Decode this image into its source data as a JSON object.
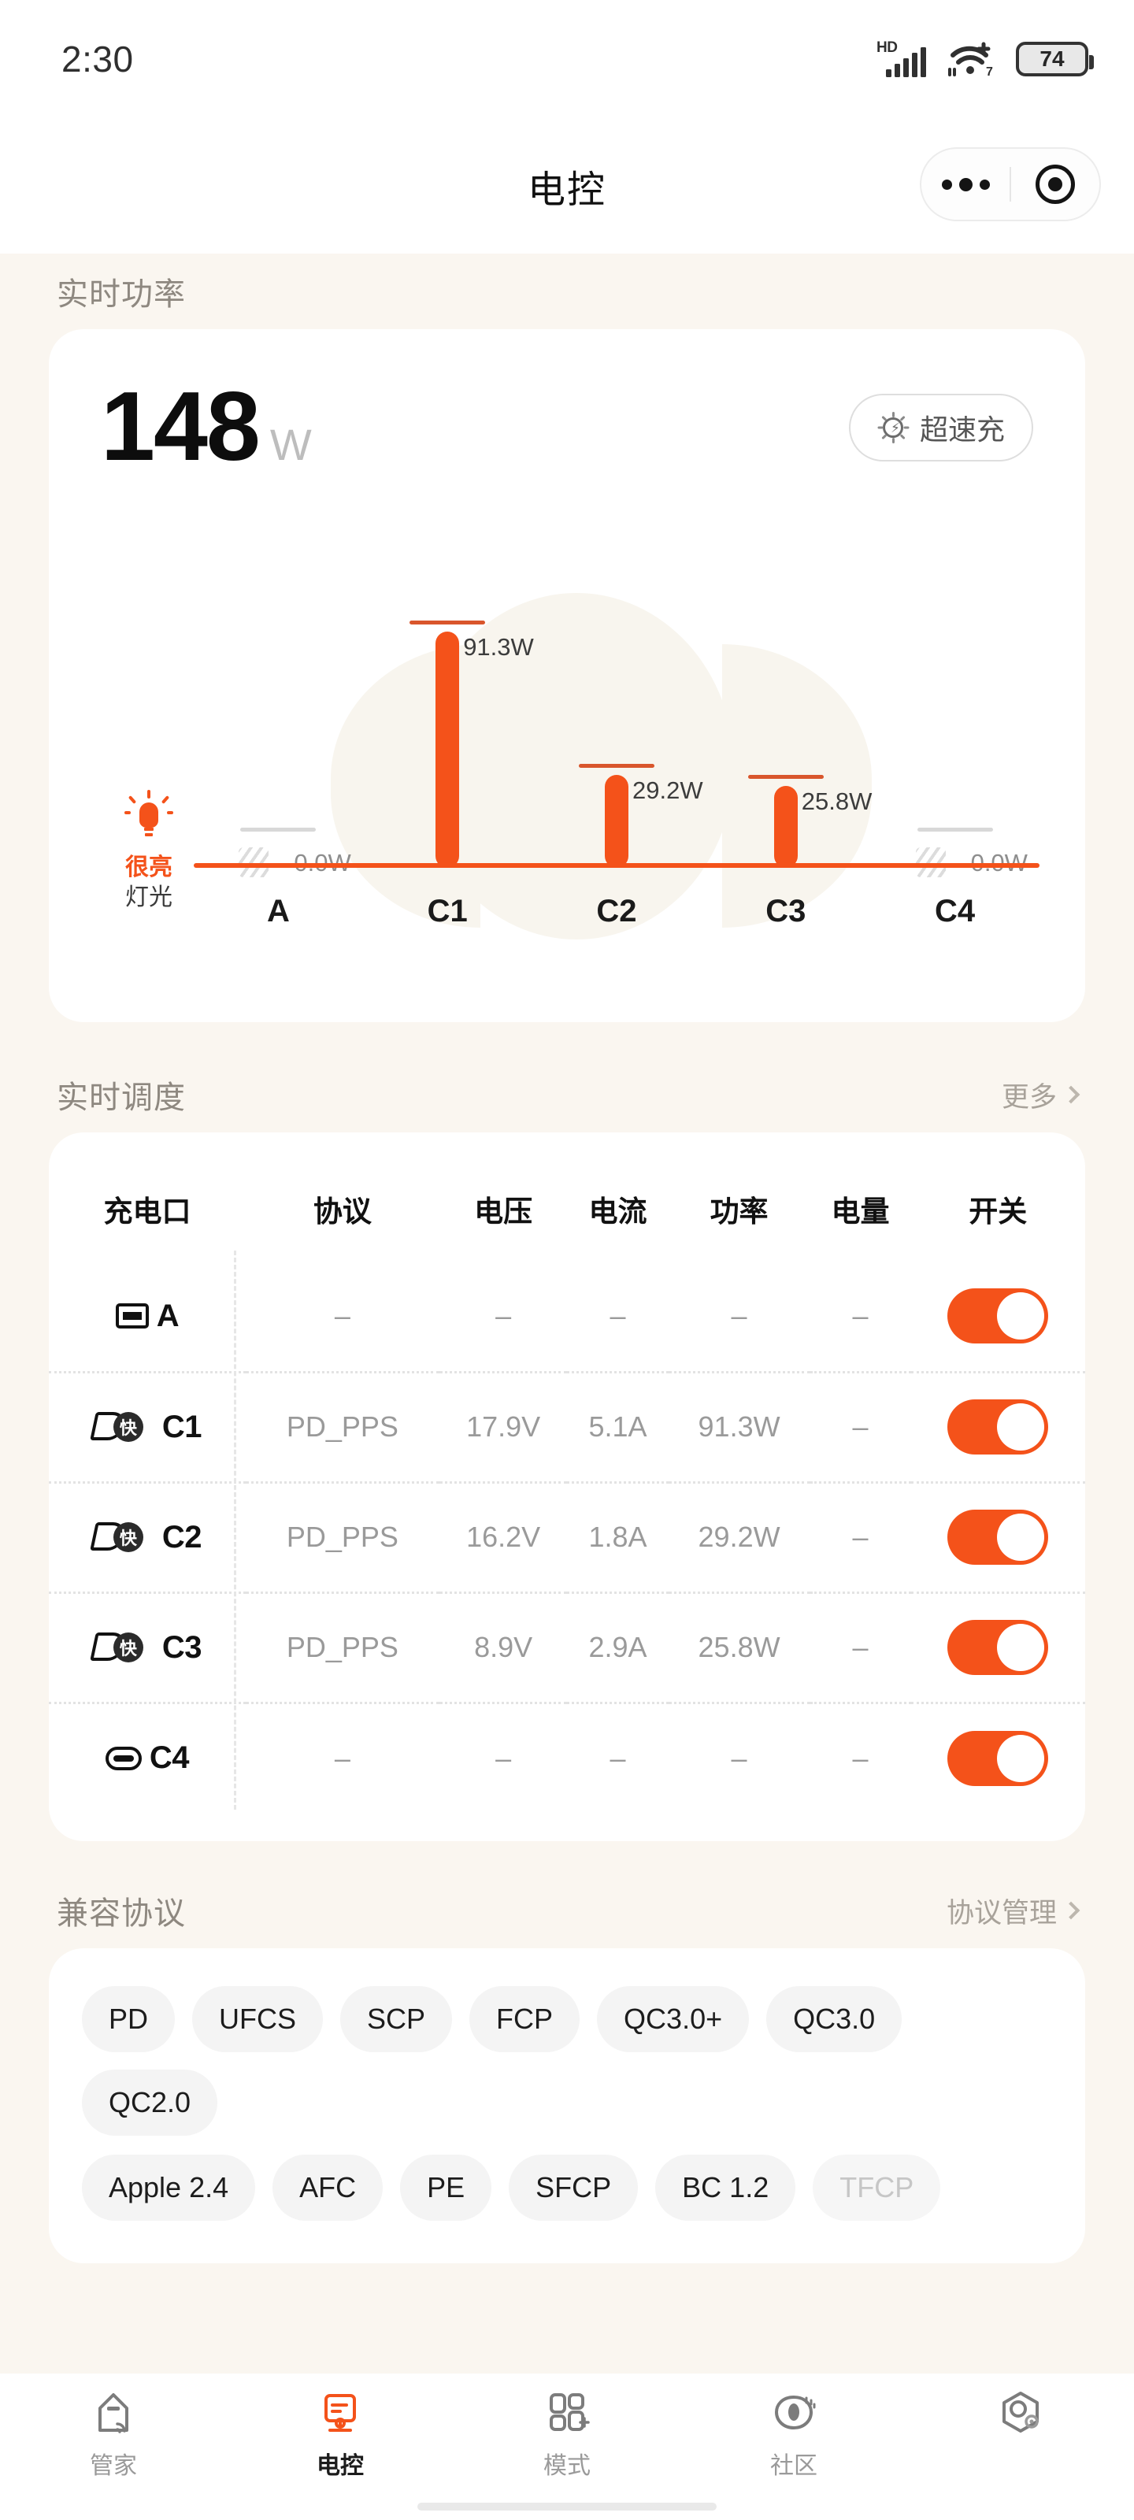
{
  "status_bar": {
    "time": "2:30",
    "network_label": "HD",
    "wifi_label": "7",
    "battery_level": "74"
  },
  "nav": {
    "title": "电控",
    "more_icon": "ellipsis-icon",
    "capsule_icon": "target-icon"
  },
  "power_section": {
    "title": "实时功率",
    "total_value": "148",
    "total_unit": "W",
    "fast_charge_label": "超速充",
    "light_status": "很亮",
    "light_label": "灯光"
  },
  "chart_data": {
    "type": "bar",
    "title": "实时功率",
    "categories": [
      "A",
      "C1",
      "C2",
      "C3",
      "C4"
    ],
    "values": [
      0.0,
      91.3,
      29.2,
      25.8,
      0.0
    ],
    "labels": [
      "0.0W",
      "91.3W",
      "29.2W",
      "25.8W",
      "0.0W"
    ],
    "unit": "W",
    "ylim": [
      0,
      100
    ],
    "grid": false,
    "xlabel": "",
    "ylabel": "",
    "active_color": "#f4521a",
    "inactive_color": "#d8d8d8",
    "total": 148
  },
  "schedule_section": {
    "title": "实时调度",
    "more_label": "更多",
    "columns": [
      "充电口",
      "协议",
      "电压",
      "电流",
      "功率",
      "电量",
      "开关"
    ],
    "rows": [
      {
        "port": "A",
        "icon": "usb-a-port-icon",
        "protocol": "–",
        "voltage": "–",
        "current": "–",
        "power": "–",
        "energy": "–",
        "switch_on": true
      },
      {
        "port": "C1",
        "icon": "usb-c-fast-port-icon",
        "protocol": "PD_PPS",
        "voltage": "17.9V",
        "current": "5.1A",
        "power": "91.3W",
        "energy": "–",
        "switch_on": true
      },
      {
        "port": "C2",
        "icon": "usb-c-fast-port-icon",
        "protocol": "PD_PPS",
        "voltage": "16.2V",
        "current": "1.8A",
        "power": "29.2W",
        "energy": "–",
        "switch_on": true
      },
      {
        "port": "C3",
        "icon": "usb-c-fast-port-icon",
        "protocol": "PD_PPS",
        "voltage": "8.9V",
        "current": "2.9A",
        "power": "25.8W",
        "energy": "–",
        "switch_on": true
      },
      {
        "port": "C4",
        "icon": "usb-c-port-icon",
        "protocol": "–",
        "voltage": "–",
        "current": "–",
        "power": "–",
        "energy": "–",
        "switch_on": true
      }
    ],
    "fast_badge": "快"
  },
  "protocol_section": {
    "title": "兼容协议",
    "manage_label": "协议管理",
    "row1": [
      {
        "label": "PD",
        "enabled": true
      },
      {
        "label": "UFCS",
        "enabled": true
      },
      {
        "label": "SCP",
        "enabled": true
      },
      {
        "label": "FCP",
        "enabled": true
      },
      {
        "label": "QC3.0+",
        "enabled": true
      },
      {
        "label": "QC3.0",
        "enabled": true
      },
      {
        "label": "QC2.0",
        "enabled": true
      }
    ],
    "row2": [
      {
        "label": "Apple 2.4",
        "enabled": true
      },
      {
        "label": "AFC",
        "enabled": true
      },
      {
        "label": "PE",
        "enabled": true
      },
      {
        "label": "SFCP",
        "enabled": true
      },
      {
        "label": "BC 1.2",
        "enabled": true
      },
      {
        "label": "TFCP",
        "enabled": false
      }
    ]
  },
  "tabbar": {
    "items": [
      {
        "label": "管家",
        "icon": "home-wifi-icon",
        "active": false
      },
      {
        "label": "电控",
        "icon": "power-control-icon",
        "active": true
      },
      {
        "label": "模式",
        "icon": "mode-add-icon",
        "active": false
      },
      {
        "label": "社区",
        "icon": "community-eye-icon",
        "active": false
      },
      {
        "label": "",
        "icon": "profile-hex-icon",
        "active": false
      }
    ]
  },
  "theme": {
    "accent": "#f4521a",
    "cap_line": "#d9562c",
    "page_bg": "#faf6f0",
    "card_bg": "#ffffff",
    "muted_text": "#9a9a9a"
  }
}
